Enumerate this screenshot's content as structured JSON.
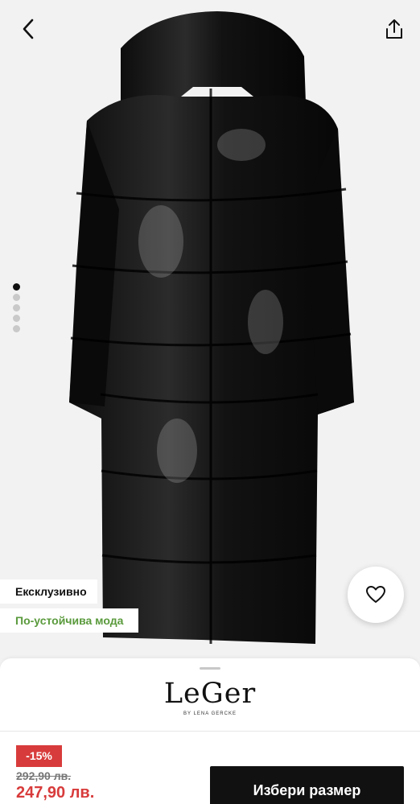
{
  "header": {
    "back_icon": "chevron-left-icon",
    "share_icon": "share-icon"
  },
  "gallery": {
    "image_count": 5,
    "active_index": 0
  },
  "badges": {
    "exclusive": "Ексклузивно",
    "sustainable": "По-устойчива мода"
  },
  "favorite": {
    "icon": "heart-icon"
  },
  "brand": {
    "name": "LeGer",
    "subtitle": "BY LENA GERCKE"
  },
  "pricing": {
    "discount": "-15%",
    "old_price": "292,90 лв.",
    "new_price": "247,90 лв."
  },
  "cta": {
    "label": "Избери размер"
  },
  "colors": {
    "sale_red": "#d83b3b",
    "sustainable_green": "#5a9a3c",
    "cta_bg": "#111111"
  }
}
